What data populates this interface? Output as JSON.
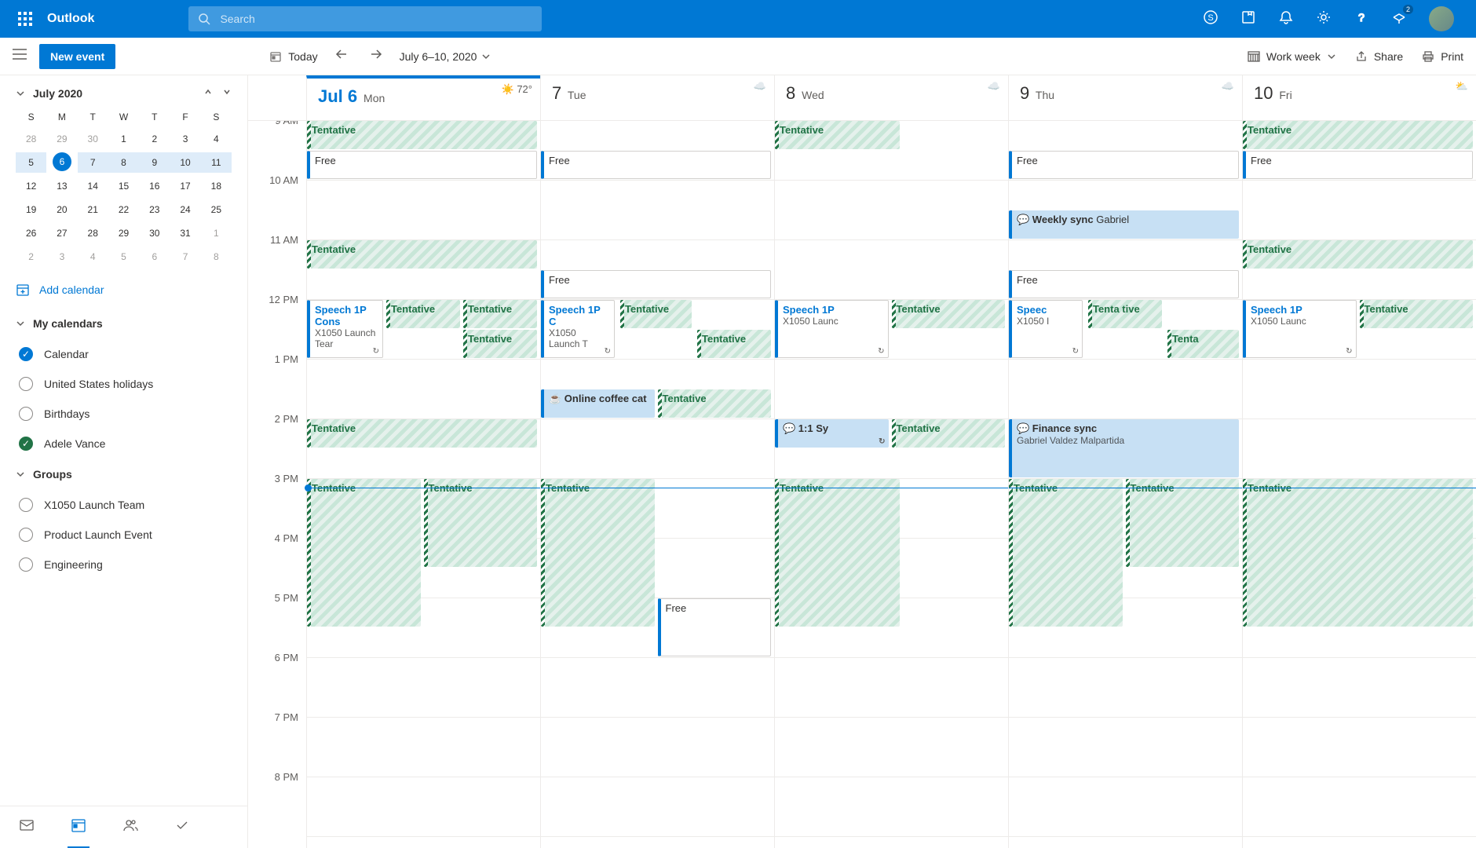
{
  "header": {
    "app_name": "Outlook",
    "search_placeholder": "Search",
    "teams_badge": "2"
  },
  "toolbar": {
    "new_event": "New event",
    "today": "Today",
    "date_range": "July 6–10, 2020",
    "view": "Work week",
    "share": "Share",
    "print": "Print"
  },
  "sidebar": {
    "mini_cal_title": "July 2020",
    "dow": [
      "S",
      "M",
      "T",
      "W",
      "T",
      "F",
      "S"
    ],
    "weeks": [
      [
        {
          "d": "28",
          "o": true
        },
        {
          "d": "29",
          "o": true
        },
        {
          "d": "30",
          "o": true
        },
        {
          "d": "1"
        },
        {
          "d": "2"
        },
        {
          "d": "3"
        },
        {
          "d": "4"
        }
      ],
      [
        {
          "d": "5"
        },
        {
          "d": "6",
          "today": true
        },
        {
          "d": "7"
        },
        {
          "d": "8"
        },
        {
          "d": "9"
        },
        {
          "d": "10"
        },
        {
          "d": "11"
        }
      ],
      [
        {
          "d": "12"
        },
        {
          "d": "13"
        },
        {
          "d": "14"
        },
        {
          "d": "15"
        },
        {
          "d": "16"
        },
        {
          "d": "17"
        },
        {
          "d": "18"
        }
      ],
      [
        {
          "d": "19"
        },
        {
          "d": "20"
        },
        {
          "d": "21"
        },
        {
          "d": "22"
        },
        {
          "d": "23"
        },
        {
          "d": "24"
        },
        {
          "d": "25"
        }
      ],
      [
        {
          "d": "26"
        },
        {
          "d": "27"
        },
        {
          "d": "28"
        },
        {
          "d": "29"
        },
        {
          "d": "30"
        },
        {
          "d": "31"
        },
        {
          "d": "1",
          "o": true
        }
      ],
      [
        {
          "d": "2",
          "o": true
        },
        {
          "d": "3",
          "o": true
        },
        {
          "d": "4",
          "o": true
        },
        {
          "d": "5",
          "o": true
        },
        {
          "d": "6",
          "o": true
        },
        {
          "d": "7",
          "o": true
        },
        {
          "d": "8",
          "o": true
        }
      ]
    ],
    "add_calendar": "Add calendar",
    "my_calendars": "My calendars",
    "calendars": [
      {
        "name": "Calendar",
        "checked": true,
        "color": "blue"
      },
      {
        "name": "United States holidays",
        "checked": false
      },
      {
        "name": "Birthdays",
        "checked": false
      },
      {
        "name": "Adele Vance",
        "checked": true,
        "color": "green"
      }
    ],
    "groups": "Groups",
    "group_items": [
      {
        "name": "X1050 Launch Team"
      },
      {
        "name": "Product Launch Event"
      },
      {
        "name": "Engineering"
      }
    ]
  },
  "days": [
    {
      "num": "Jul 6",
      "name": "Mon",
      "today": true,
      "weather": "72°",
      "wicon": "sun"
    },
    {
      "num": "7",
      "name": "Tue",
      "wicon": "cloud"
    },
    {
      "num": "8",
      "name": "Wed",
      "wicon": "cloud"
    },
    {
      "num": "9",
      "name": "Thu",
      "wicon": "cloud"
    },
    {
      "num": "10",
      "name": "Fri",
      "wicon": "partly"
    }
  ],
  "hours": [
    "9 AM",
    "10 AM",
    "11 AM",
    "12 PM",
    "1 PM",
    "2 PM",
    "3 PM",
    "4 PM",
    "5 PM",
    "6 PM",
    "7 PM",
    "8 PM"
  ],
  "now_hour_offset": 6.15,
  "events": {
    "mon": [
      {
        "t": 0,
        "h": 0.5,
        "w": 1,
        "x": 0,
        "cls": "ev-tentative",
        "title": "Tentative"
      },
      {
        "t": 0.5,
        "h": 0.5,
        "w": 1,
        "x": 0,
        "cls": "ev-free",
        "title": "Free"
      },
      {
        "t": 2,
        "h": 0.5,
        "w": 1,
        "x": 0,
        "cls": "ev-tentative",
        "title": "Tentative"
      },
      {
        "t": 3,
        "h": 1,
        "w": 0.34,
        "x": 0,
        "cls": "ev-free",
        "title": "Speech 1P Cons",
        "sub": "X1050 Launch Tear",
        "recur": true,
        "bld": true
      },
      {
        "t": 3,
        "h": 0.5,
        "w": 0.33,
        "x": 0.34,
        "cls": "ev-tentative",
        "title": "Tentative"
      },
      {
        "t": 3,
        "h": 0.5,
        "w": 0.33,
        "x": 0.67,
        "cls": "ev-tentative",
        "title": "Tentative"
      },
      {
        "t": 3.5,
        "h": 0.5,
        "w": 0.33,
        "x": 0.67,
        "cls": "ev-tentative",
        "title": "Tentative"
      },
      {
        "t": 5,
        "h": 0.5,
        "w": 1,
        "x": 0,
        "cls": "ev-tentative",
        "title": "Tentative"
      },
      {
        "t": 6,
        "h": 2.5,
        "w": 0.5,
        "x": 0,
        "cls": "ev-tentative",
        "title": "Tentative"
      },
      {
        "t": 6,
        "h": 1.5,
        "w": 0.5,
        "x": 0.5,
        "cls": "ev-tentative",
        "title": "Tentative"
      }
    ],
    "tue": [
      {
        "t": 0.5,
        "h": 0.5,
        "w": 1,
        "x": 0,
        "cls": "ev-free",
        "title": "Free"
      },
      {
        "t": 2.5,
        "h": 0.5,
        "w": 1,
        "x": 0,
        "cls": "ev-free",
        "title": "Free"
      },
      {
        "t": 3,
        "h": 1,
        "w": 0.33,
        "x": 0,
        "cls": "ev-free",
        "title": "Speech 1P C",
        "sub": "X1050 Launch T",
        "recur": true,
        "bld": true
      },
      {
        "t": 3,
        "h": 0.5,
        "w": 0.32,
        "x": 0.34,
        "cls": "ev-tentative",
        "title": "Tentative"
      },
      {
        "t": 3.5,
        "h": 0.5,
        "w": 0.33,
        "x": 0.67,
        "cls": "ev-tentative",
        "title": "Tentative"
      },
      {
        "t": 4.5,
        "h": 0.5,
        "w": 0.5,
        "x": 0,
        "cls": "ev-busy",
        "title": "☕ Online coffee cat"
      },
      {
        "t": 4.5,
        "h": 0.5,
        "w": 0.5,
        "x": 0.5,
        "cls": "ev-tentative",
        "title": "Tentative"
      },
      {
        "t": 6,
        "h": 2.5,
        "w": 0.5,
        "x": 0,
        "cls": "ev-tentative",
        "title": "Tentative"
      },
      {
        "t": 8,
        "h": 1,
        "w": 0.5,
        "x": 0.5,
        "cls": "ev-free",
        "title": "Free"
      }
    ],
    "wed": [
      {
        "t": 0,
        "h": 0.5,
        "w": 0.55,
        "x": 0,
        "cls": "ev-tentative",
        "title": "Tentative"
      },
      {
        "t": 3,
        "h": 1,
        "w": 0.5,
        "x": 0,
        "cls": "ev-free",
        "title": "Speech 1P",
        "sub": "X1050 Launc",
        "recur": true,
        "bld": true
      },
      {
        "t": 3,
        "h": 0.5,
        "w": 0.5,
        "x": 0.5,
        "cls": "ev-tentative",
        "title": "Tentative"
      },
      {
        "t": 5,
        "h": 0.5,
        "w": 0.5,
        "x": 0,
        "cls": "ev-busy",
        "title": "💬 1:1 Sy",
        "recur": true
      },
      {
        "t": 5,
        "h": 0.5,
        "w": 0.5,
        "x": 0.5,
        "cls": "ev-tentative",
        "title": "Tentative"
      },
      {
        "t": 6,
        "h": 2.5,
        "w": 0.55,
        "x": 0,
        "cls": "ev-tentative",
        "title": "Tentative"
      }
    ],
    "thu": [
      {
        "t": 0.5,
        "h": 0.5,
        "w": 1,
        "x": 0,
        "cls": "ev-free",
        "title": "Free"
      },
      {
        "t": 1.5,
        "h": 0.5,
        "w": 1,
        "x": 0,
        "cls": "ev-busy",
        "title": "💬 Weekly sync",
        "sub2": "Gabriel"
      },
      {
        "t": 2.5,
        "h": 0.5,
        "w": 1,
        "x": 0,
        "cls": "ev-free",
        "title": "Free"
      },
      {
        "t": 3,
        "h": 1,
        "w": 0.33,
        "x": 0,
        "cls": "ev-free",
        "title": "Speec",
        "sub": "X1050 I",
        "recur": true,
        "bld": true
      },
      {
        "t": 3,
        "h": 0.5,
        "w": 0.33,
        "x": 0.34,
        "cls": "ev-tentative",
        "title": "Tenta tive"
      },
      {
        "t": 3.5,
        "h": 0.5,
        "w": 0.32,
        "x": 0.68,
        "cls": "ev-tentative",
        "title": "Tenta"
      },
      {
        "t": 5,
        "h": 1,
        "w": 1,
        "x": 0,
        "cls": "ev-busy",
        "title": "💬 Finance sync",
        "sub": "Gabriel Valdez Malpartida"
      },
      {
        "t": 6,
        "h": 2.5,
        "w": 0.5,
        "x": 0,
        "cls": "ev-tentative",
        "title": "Tentative"
      },
      {
        "t": 6,
        "h": 1.5,
        "w": 0.5,
        "x": 0.5,
        "cls": "ev-tentative",
        "title": "Tentative"
      }
    ],
    "fri": [
      {
        "t": 0,
        "h": 0.5,
        "w": 1,
        "x": 0,
        "cls": "ev-tentative",
        "title": "Tentative"
      },
      {
        "t": 0.5,
        "h": 0.5,
        "w": 1,
        "x": 0,
        "cls": "ev-free",
        "title": "Free"
      },
      {
        "t": 2,
        "h": 0.5,
        "w": 1,
        "x": 0,
        "cls": "ev-tentative",
        "title": "Tentative"
      },
      {
        "t": 3,
        "h": 1,
        "w": 0.5,
        "x": 0,
        "cls": "ev-free",
        "title": "Speech 1P",
        "sub": "X1050 Launc",
        "recur": true,
        "bld": true
      },
      {
        "t": 3,
        "h": 0.5,
        "w": 0.5,
        "x": 0.5,
        "cls": "ev-tentative",
        "title": "Tentative"
      },
      {
        "t": 6,
        "h": 2.5,
        "w": 1,
        "x": 0,
        "cls": "ev-tentative",
        "title": "Tentative"
      }
    ]
  }
}
